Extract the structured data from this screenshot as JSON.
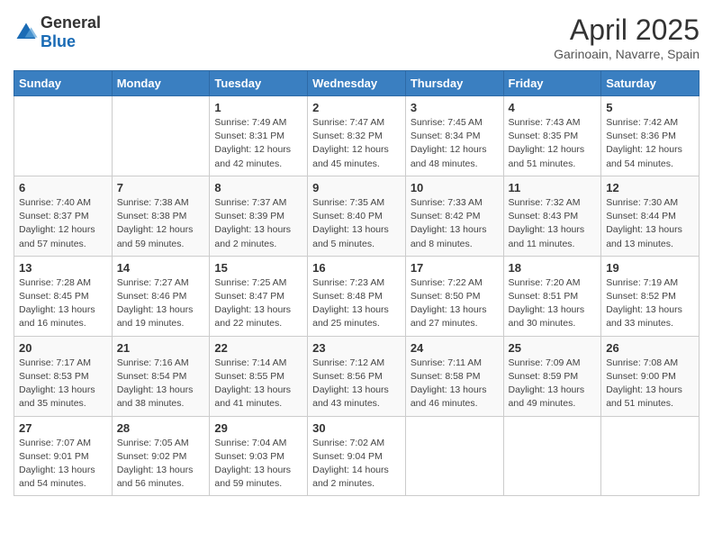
{
  "header": {
    "logo_general": "General",
    "logo_blue": "Blue",
    "month": "April 2025",
    "location": "Garinoain, Navarre, Spain"
  },
  "weekdays": [
    "Sunday",
    "Monday",
    "Tuesday",
    "Wednesday",
    "Thursday",
    "Friday",
    "Saturday"
  ],
  "weeks": [
    [
      {
        "day": "",
        "info": ""
      },
      {
        "day": "",
        "info": ""
      },
      {
        "day": "1",
        "info": "Sunrise: 7:49 AM\nSunset: 8:31 PM\nDaylight: 12 hours and 42 minutes."
      },
      {
        "day": "2",
        "info": "Sunrise: 7:47 AM\nSunset: 8:32 PM\nDaylight: 12 hours and 45 minutes."
      },
      {
        "day": "3",
        "info": "Sunrise: 7:45 AM\nSunset: 8:34 PM\nDaylight: 12 hours and 48 minutes."
      },
      {
        "day": "4",
        "info": "Sunrise: 7:43 AM\nSunset: 8:35 PM\nDaylight: 12 hours and 51 minutes."
      },
      {
        "day": "5",
        "info": "Sunrise: 7:42 AM\nSunset: 8:36 PM\nDaylight: 12 hours and 54 minutes."
      }
    ],
    [
      {
        "day": "6",
        "info": "Sunrise: 7:40 AM\nSunset: 8:37 PM\nDaylight: 12 hours and 57 minutes."
      },
      {
        "day": "7",
        "info": "Sunrise: 7:38 AM\nSunset: 8:38 PM\nDaylight: 12 hours and 59 minutes."
      },
      {
        "day": "8",
        "info": "Sunrise: 7:37 AM\nSunset: 8:39 PM\nDaylight: 13 hours and 2 minutes."
      },
      {
        "day": "9",
        "info": "Sunrise: 7:35 AM\nSunset: 8:40 PM\nDaylight: 13 hours and 5 minutes."
      },
      {
        "day": "10",
        "info": "Sunrise: 7:33 AM\nSunset: 8:42 PM\nDaylight: 13 hours and 8 minutes."
      },
      {
        "day": "11",
        "info": "Sunrise: 7:32 AM\nSunset: 8:43 PM\nDaylight: 13 hours and 11 minutes."
      },
      {
        "day": "12",
        "info": "Sunrise: 7:30 AM\nSunset: 8:44 PM\nDaylight: 13 hours and 13 minutes."
      }
    ],
    [
      {
        "day": "13",
        "info": "Sunrise: 7:28 AM\nSunset: 8:45 PM\nDaylight: 13 hours and 16 minutes."
      },
      {
        "day": "14",
        "info": "Sunrise: 7:27 AM\nSunset: 8:46 PM\nDaylight: 13 hours and 19 minutes."
      },
      {
        "day": "15",
        "info": "Sunrise: 7:25 AM\nSunset: 8:47 PM\nDaylight: 13 hours and 22 minutes."
      },
      {
        "day": "16",
        "info": "Sunrise: 7:23 AM\nSunset: 8:48 PM\nDaylight: 13 hours and 25 minutes."
      },
      {
        "day": "17",
        "info": "Sunrise: 7:22 AM\nSunset: 8:50 PM\nDaylight: 13 hours and 27 minutes."
      },
      {
        "day": "18",
        "info": "Sunrise: 7:20 AM\nSunset: 8:51 PM\nDaylight: 13 hours and 30 minutes."
      },
      {
        "day": "19",
        "info": "Sunrise: 7:19 AM\nSunset: 8:52 PM\nDaylight: 13 hours and 33 minutes."
      }
    ],
    [
      {
        "day": "20",
        "info": "Sunrise: 7:17 AM\nSunset: 8:53 PM\nDaylight: 13 hours and 35 minutes."
      },
      {
        "day": "21",
        "info": "Sunrise: 7:16 AM\nSunset: 8:54 PM\nDaylight: 13 hours and 38 minutes."
      },
      {
        "day": "22",
        "info": "Sunrise: 7:14 AM\nSunset: 8:55 PM\nDaylight: 13 hours and 41 minutes."
      },
      {
        "day": "23",
        "info": "Sunrise: 7:12 AM\nSunset: 8:56 PM\nDaylight: 13 hours and 43 minutes."
      },
      {
        "day": "24",
        "info": "Sunrise: 7:11 AM\nSunset: 8:58 PM\nDaylight: 13 hours and 46 minutes."
      },
      {
        "day": "25",
        "info": "Sunrise: 7:09 AM\nSunset: 8:59 PM\nDaylight: 13 hours and 49 minutes."
      },
      {
        "day": "26",
        "info": "Sunrise: 7:08 AM\nSunset: 9:00 PM\nDaylight: 13 hours and 51 minutes."
      }
    ],
    [
      {
        "day": "27",
        "info": "Sunrise: 7:07 AM\nSunset: 9:01 PM\nDaylight: 13 hours and 54 minutes."
      },
      {
        "day": "28",
        "info": "Sunrise: 7:05 AM\nSunset: 9:02 PM\nDaylight: 13 hours and 56 minutes."
      },
      {
        "day": "29",
        "info": "Sunrise: 7:04 AM\nSunset: 9:03 PM\nDaylight: 13 hours and 59 minutes."
      },
      {
        "day": "30",
        "info": "Sunrise: 7:02 AM\nSunset: 9:04 PM\nDaylight: 14 hours and 2 minutes."
      },
      {
        "day": "",
        "info": ""
      },
      {
        "day": "",
        "info": ""
      },
      {
        "day": "",
        "info": ""
      }
    ]
  ]
}
